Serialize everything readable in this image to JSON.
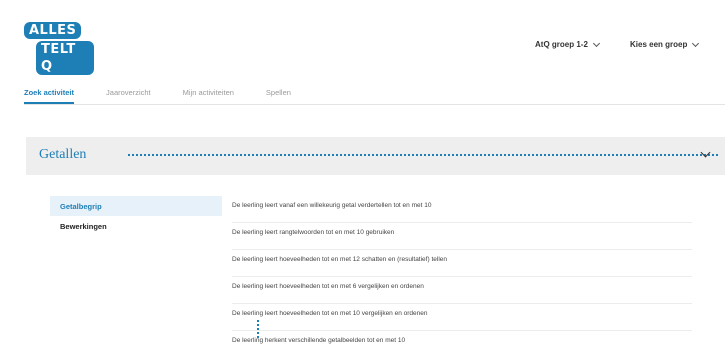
{
  "header": {
    "logo_line1": "ALLES",
    "logo_line2": "TELT Q",
    "group_select": "AtQ groep 1-2",
    "group_choose": "Kies een groep"
  },
  "tabs": [
    {
      "label": "Zoek activiteit",
      "active": true
    },
    {
      "label": "Jaaroverzicht",
      "active": false
    },
    {
      "label": "Mijn activiteiten",
      "active": false
    },
    {
      "label": "Spellen",
      "active": false
    }
  ],
  "section": {
    "title": "Getallen"
  },
  "categories": [
    {
      "label": "Getalbegrip",
      "active": true
    },
    {
      "label": "Bewerkingen",
      "active": false
    }
  ],
  "goals": [
    "De leerling leert vanaf een willekeurig getal verdertellen tot en met 10",
    "De leerling leert rangtelwoorden tot en met 10 gebruiken",
    "De leerling leert hoeveelheden tot en met 12 schatten en (resultatief) tellen",
    "De leerling leert hoeveelheden tot en met 6 vergelijken en ordenen",
    "De leerling leert hoeveelheden tot en met 10 vergelijken en ordenen",
    "De leerling herkent verschillende getalbeelden tot en met 10"
  ],
  "colors": {
    "accent": "#1e7fb7",
    "section_bg": "#eeeeee",
    "active_bg": "#e6f1f9"
  }
}
